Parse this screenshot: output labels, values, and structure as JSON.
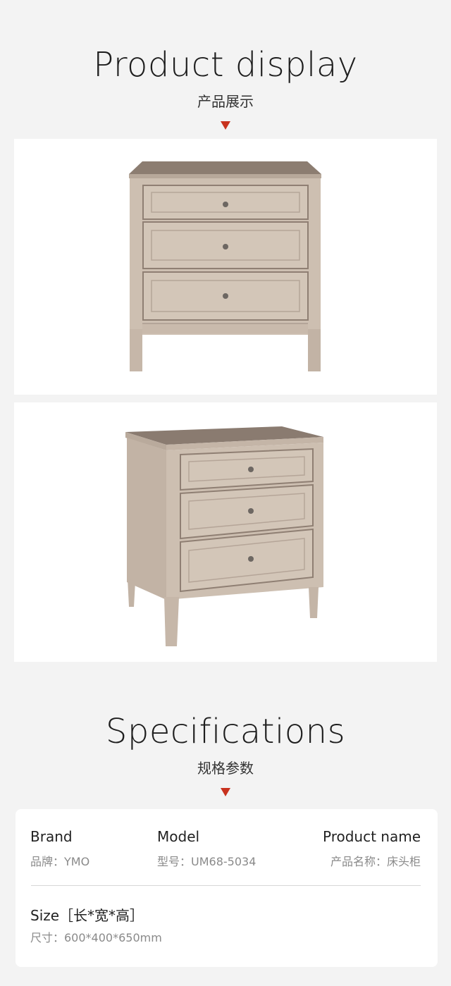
{
  "display": {
    "title": "Product display",
    "subtitle": "产品展示",
    "images": [
      {
        "name": "nightstand-front-view"
      },
      {
        "name": "nightstand-angled-view"
      }
    ]
  },
  "specs": {
    "title": "Specifications",
    "subtitle": "规格参数",
    "brand": {
      "label": "Brand",
      "value": "品牌：YMO"
    },
    "model": {
      "label": "Model",
      "value": "型号：UM68-5034"
    },
    "product_name": {
      "label": "Product name",
      "value": "产品名称：床头柜"
    },
    "size": {
      "label": "Size［长*宽*高］",
      "value": "尺寸：600*400*650mm"
    }
  },
  "colors": {
    "accent": "#c8321e",
    "wood": "#cdbfb1",
    "wood_dark": "#7e6e62",
    "background": "#f3f3f3"
  }
}
